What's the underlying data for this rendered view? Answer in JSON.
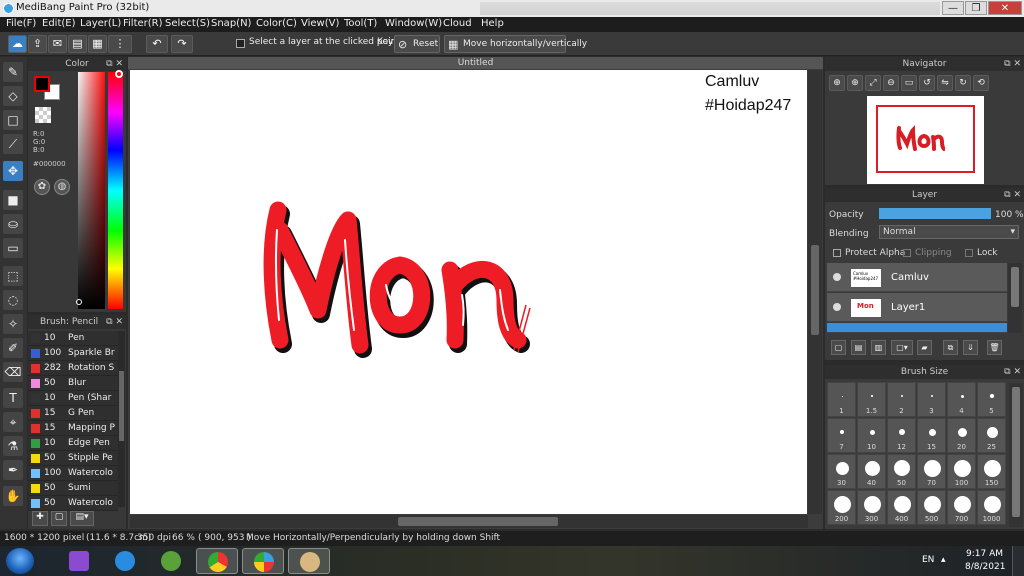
{
  "window": {
    "title": "MediBang Paint Pro (32bit)",
    "controls": {
      "minimize": "—",
      "restore": "❐",
      "close": "✕"
    }
  },
  "menu": [
    "File(F)",
    "Edit(E)",
    "Layer(L)",
    "Filter(R)",
    "Select(S)",
    "Snap(N)",
    "Color(C)",
    "View(V)",
    "Tool(T)",
    "Window(W)",
    "Cloud",
    "Help"
  ],
  "toolbar": {
    "select_layer_label": "Select a layer at the clicked point",
    "key_label": "Key",
    "reset_label": "Reset",
    "move_label": "Move horizontally/vertically"
  },
  "color_panel": {
    "title": "Color",
    "r": "R:0",
    "g": "G:0",
    "b": "B:0",
    "hex": "#000000",
    "fg_color": "#000000",
    "bg_color": "#ffffff",
    "main_hue": "#ff0000"
  },
  "brush_panel": {
    "title": "Brush: Pencil",
    "brushes": [
      {
        "size": "10",
        "name": "Pen",
        "color": "#333333"
      },
      {
        "size": "100",
        "name": "Sparkle Br",
        "color": "#3b5bdb"
      },
      {
        "size": "282",
        "name": "Rotation S",
        "color": "#e03131"
      },
      {
        "size": "50",
        "name": "Blur",
        "color": "#f08ae0"
      },
      {
        "size": "10",
        "name": "Pen (Shar",
        "color": "#333333"
      },
      {
        "size": "15",
        "name": "G Pen",
        "color": "#e03131"
      },
      {
        "size": "15",
        "name": "Mapping P",
        "color": "#e03131"
      },
      {
        "size": "10",
        "name": "Edge Pen",
        "color": "#2f9e44"
      },
      {
        "size": "50",
        "name": "Stipple Pe",
        "color": "#f5d90a"
      },
      {
        "size": "100",
        "name": "Watercolo",
        "color": "#74c0fc"
      },
      {
        "size": "50",
        "name": "Sumi",
        "color": "#f5d90a"
      },
      {
        "size": "50",
        "name": "Watercolo",
        "color": "#74c0fc"
      }
    ]
  },
  "canvas": {
    "tab_title": "Untitled",
    "watermark_line1": "Camluv",
    "watermark_line2": "#Hoidap247",
    "art_text": "Mon"
  },
  "navigator": {
    "title": "Navigator"
  },
  "layer_panel": {
    "title": "Layer",
    "opacity_label": "Opacity",
    "opacity_value": "100 %",
    "opacity_fraction": 1.0,
    "blending_label": "Blending",
    "blending_value": "Normal",
    "protect_alpha": "Protect Alpha",
    "clipping": "Clipping",
    "lock": "Lock",
    "layers": [
      {
        "name": "Camluv"
      },
      {
        "name": "Layer1"
      }
    ]
  },
  "brush_size": {
    "title": "Brush Size",
    "sizes": [
      "1",
      "1.5",
      "2",
      "3",
      "4",
      "5",
      "7",
      "10",
      "12",
      "15",
      "20",
      "25",
      "30",
      "40",
      "50",
      "70",
      "100",
      "150",
      "200",
      "300",
      "400",
      "500",
      "700",
      "1000"
    ]
  },
  "status": {
    "dimensions": "1600 * 1200 pixel",
    "physical": "(11.6 * 8.7cm)",
    "dpi": "350 dpi",
    "zoom": "66 %",
    "coords": "( 900, 953 )",
    "hint": "Move Horizontally/Perpendicularly by holding down Shift"
  },
  "taskbar": {
    "language": "EN",
    "time": "9:17 AM",
    "date": "8/8/2021"
  }
}
